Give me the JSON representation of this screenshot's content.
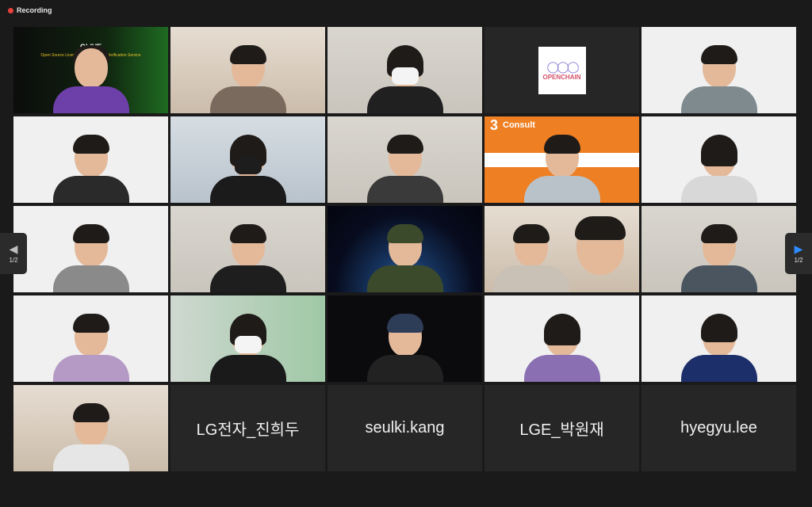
{
  "recording": {
    "label": "Recording"
  },
  "slide": {
    "title": "OLIVE",
    "subtitle": "Open Source License Identification & Verification Service"
  },
  "openchain": {
    "logo_text": "OPENCHAIN"
  },
  "consult": {
    "number": "3",
    "label": "Consult"
  },
  "name_tiles": [
    {
      "name": "LG전자_진희두"
    },
    {
      "name": "seulki.kang"
    },
    {
      "name": "LGE_박원재"
    },
    {
      "name": "hyegyu.lee"
    }
  ],
  "pagination": {
    "left": {
      "icon": "chevron-left-icon",
      "count": "1/2"
    },
    "right": {
      "icon": "chevron-right-icon",
      "count": "1/2"
    }
  },
  "colors": {
    "accent": "#2d8cff",
    "active_speaker_border": "#c8e86a",
    "recording_dot": "#e8413b"
  }
}
